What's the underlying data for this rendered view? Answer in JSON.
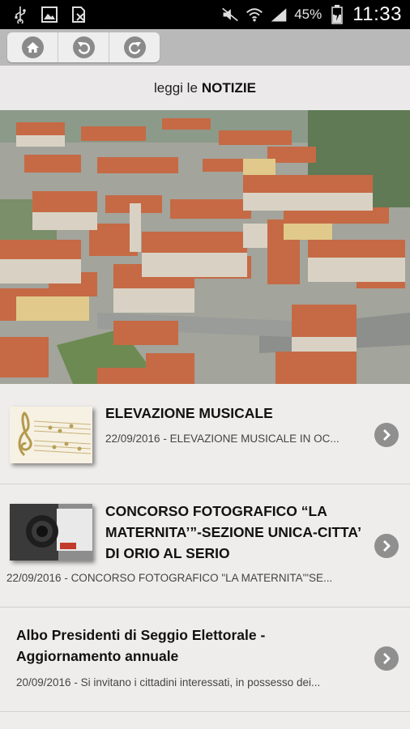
{
  "status_bar": {
    "icons": [
      "usb-icon",
      "image-icon",
      "file-disabled-icon",
      "mute-icon",
      "wifi-icon",
      "signal-icon",
      "battery-icon"
    ],
    "battery_percent": "45%",
    "time": "11:33"
  },
  "toolbar": {
    "buttons": [
      "home-icon",
      "back-icon",
      "refresh-icon"
    ]
  },
  "header": {
    "prefix": "leggi le",
    "title": "NOTIZIE"
  },
  "news": [
    {
      "title": "ELEVAZIONE MUSICALE",
      "subtitle": "22/09/2016 - ELEVAZIONE MUSICALE IN OC..."
    },
    {
      "title": "CONCORSO FOTOGRAFICO “LA MATERNITA’”-SEZIONE UNICA-CITTA’ DI ORIO AL SERIO",
      "subtitle": "22/09/2016 - CONCORSO FOTOGRAFICO \"LA MATERNITA'\"SE..."
    },
    {
      "title": "Albo Presidenti di Seggio Elettorale - Aggiornamento annuale",
      "subtitle": "20/09/2016 - Si invitano i cittadini interessati, in possesso dei..."
    }
  ],
  "colors": {
    "toolbar": "#b9b9b9",
    "background": "#efedec",
    "chevron": "#8f8f8f"
  }
}
